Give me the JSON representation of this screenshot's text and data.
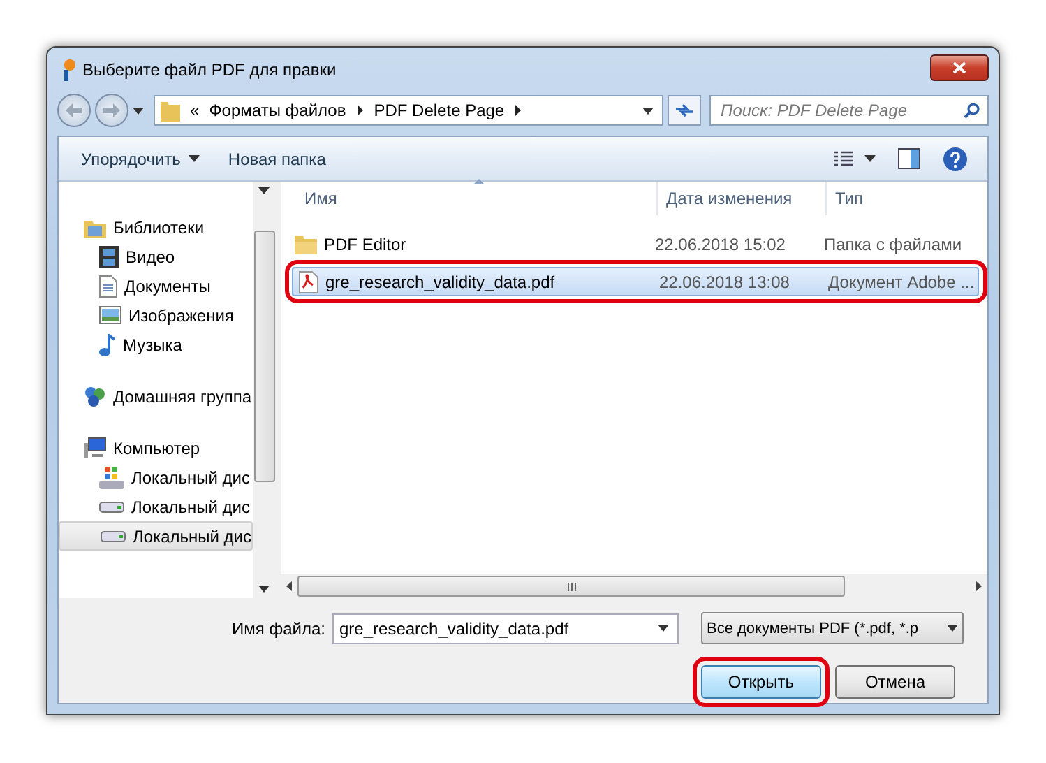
{
  "window": {
    "title": "Выберите файл PDF для правки"
  },
  "address": {
    "prefix": "«",
    "crumbs": [
      "Форматы файлов",
      "PDF Delete Page"
    ]
  },
  "search": {
    "placeholder": "Поиск: PDF Delete Page"
  },
  "toolbar": {
    "organize": "Упорядочить",
    "new_folder": "Новая папка"
  },
  "sidebar": {
    "items": [
      {
        "label": "Библиотеки",
        "kind": "library",
        "selected": false,
        "children": [
          {
            "label": "Видео",
            "kind": "video",
            "selected": false
          },
          {
            "label": "Документы",
            "kind": "documents",
            "selected": false
          },
          {
            "label": "Изображения",
            "kind": "pictures",
            "selected": false
          },
          {
            "label": "Музыка",
            "kind": "music",
            "selected": false
          }
        ]
      },
      {
        "label": "Домашняя группа",
        "kind": "homegroup",
        "selected": false
      },
      {
        "label": "Компьютер",
        "kind": "computer",
        "selected": false,
        "children": [
          {
            "label": "Локальный дис",
            "kind": "system-disk",
            "selected": false
          },
          {
            "label": "Локальный дис",
            "kind": "disk",
            "selected": false
          },
          {
            "label": "Локальный дис",
            "kind": "disk",
            "selected": true
          }
        ]
      }
    ]
  },
  "table": {
    "columns": [
      "Имя",
      "Дата изменения",
      "Тип"
    ],
    "rows": [
      {
        "kind": "folder",
        "name": "PDF Editor",
        "date": "22.06.2018 15:02",
        "type": "Папка с файлами",
        "selected": false,
        "highlighted": false
      },
      {
        "kind": "pdf",
        "name": "gre_research_validity_data.pdf",
        "date": "22.06.2018 13:08",
        "type": "Документ Adobe ...",
        "selected": true,
        "highlighted": true
      }
    ]
  },
  "bottom": {
    "filename_label": "Имя файла:",
    "filename": "gre_research_validity_data.pdf",
    "filter": "Все документы PDF (*.pdf, *.p",
    "buttons": [
      {
        "label": "Открыть",
        "kind": "primary",
        "highlighted": true
      },
      {
        "label": "Отмена",
        "kind": "normal",
        "highlighted": false
      }
    ]
  }
}
